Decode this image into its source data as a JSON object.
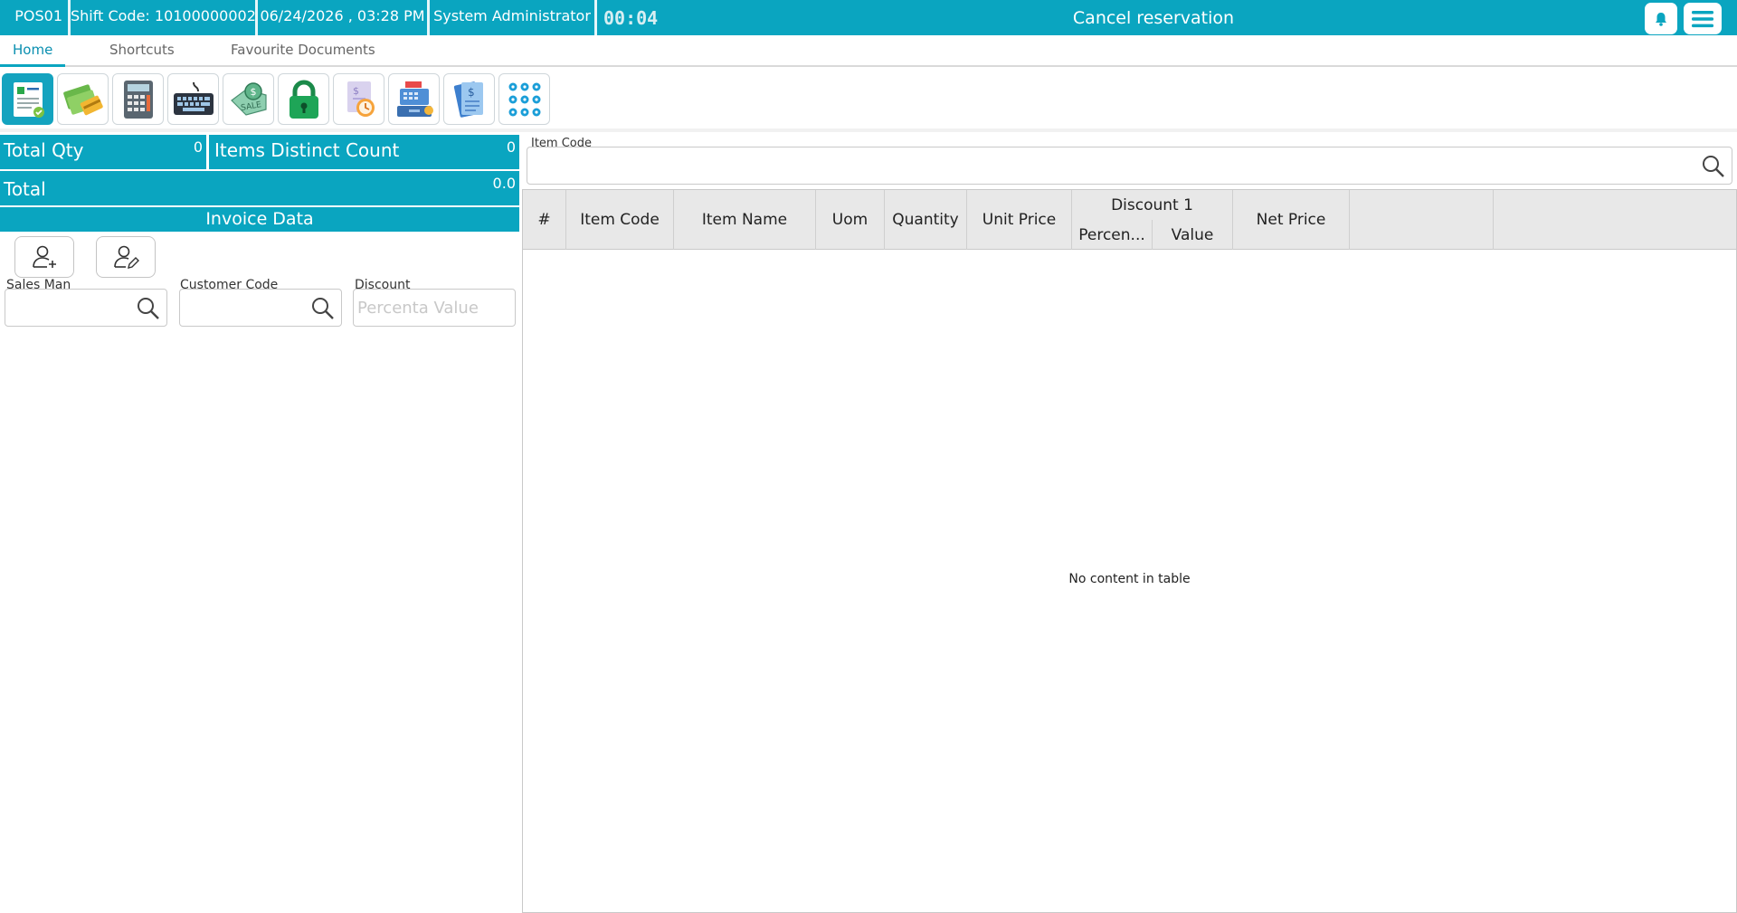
{
  "topbar": {
    "pos": "POS01",
    "shift": "Shift Code: 10100000002",
    "datetime": "06/24/2026 , 03:28 PM",
    "user": "System Administrator",
    "timer": "00:04",
    "title": "Cancel reservation",
    "bell_icon": "bell-icon",
    "menu_icon": "hamburger-menu-icon",
    "color": "#0aa5c0"
  },
  "tabs": [
    {
      "label": "Home",
      "active": true
    },
    {
      "label": "Shortcuts",
      "active": false
    },
    {
      "label": "Favourite Documents",
      "active": false
    }
  ],
  "toolbar": {
    "icons": [
      "invoice-icon",
      "cash-card-icon",
      "calculator-icon",
      "keyboard-icon",
      "sale-tag-icon",
      "lock-icon",
      "price-clock-icon",
      "cash-register-icon",
      "receipt-icon",
      "numpad-icon"
    ]
  },
  "summary": {
    "total_qty_label": "Total Qty",
    "total_qty_value": "0",
    "distinct_label": "Items Distinct Count",
    "distinct_value": "0",
    "total_label": "Total",
    "total_value": "0.0"
  },
  "invoice": {
    "header": "Invoice Data",
    "salesman_label": "Sales Man",
    "customer_label": "Customer Code",
    "discount_label": "Discount",
    "discount_placeholder": "Percenta Value"
  },
  "item_search": {
    "label": "Item Code"
  },
  "grid": {
    "columns": [
      "#",
      "Item Code",
      "Item Name",
      "Uom",
      "Quantity",
      "Unit Price",
      "Discount 1",
      "Percen...",
      "Value",
      "Net Price"
    ],
    "empty_text": "No content in table"
  }
}
